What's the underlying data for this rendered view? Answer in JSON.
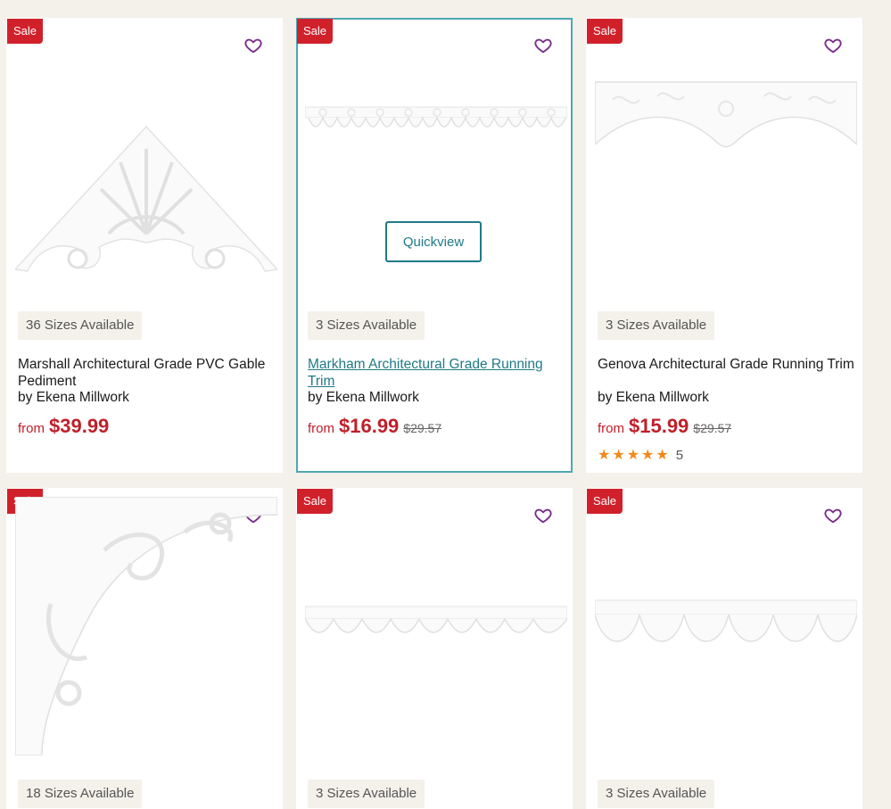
{
  "products": [
    {
      "badge": "Sale",
      "sizes": "36 Sizes Available",
      "title": "Marshall Architectural Grade PVC Gable Pediment",
      "brand": "by Ekena Millwork",
      "from": "from",
      "price": "$39.99",
      "was": "",
      "image": "gable-pediment-image"
    },
    {
      "badge": "Sale",
      "sizes": "3 Sizes Available",
      "title": "Markham Architectural Grade Running Trim",
      "brand": "by Ekena Millwork",
      "from": "from",
      "price": "$16.99",
      "was": "$29.57",
      "quickview": "Quickview",
      "image": "running-trim-image"
    },
    {
      "badge": "Sale",
      "sizes": "3 Sizes Available",
      "title": "Genova Architectural Grade Running Trim",
      "brand": "by Ekena Millwork",
      "from": "from",
      "price": "$15.99",
      "was": "$29.57",
      "rating": 5,
      "reviews": "5",
      "image": "running-trim-image"
    },
    {
      "badge": "Sale",
      "sizes": "18 Sizes Available",
      "image": "bracket-image"
    },
    {
      "badge": "Sale",
      "sizes": "3 Sizes Available",
      "image": "running-trim-image"
    },
    {
      "badge": "Sale",
      "sizes": "3 Sizes Available",
      "image": "running-trim-image"
    }
  ],
  "colors": {
    "sale": "#d0212b",
    "price": "#c0202b",
    "accent": "#1f7a86",
    "wishlist": "#7a2b8c",
    "star": "#f08a1c",
    "background": "#f3f1ea"
  },
  "icons": {
    "wishlist": "heart-outline-icon",
    "star": "star-icon"
  }
}
